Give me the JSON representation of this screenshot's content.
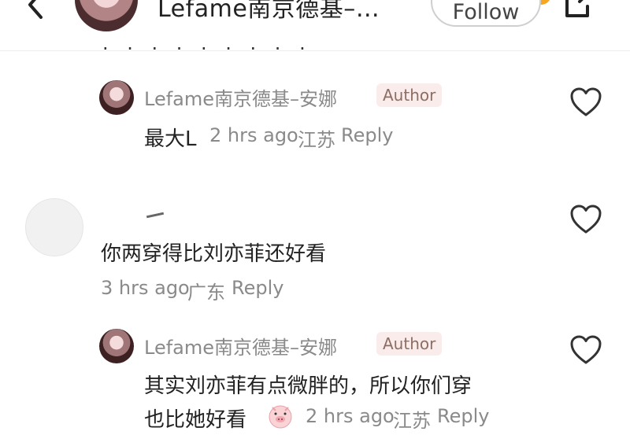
{
  "header": {
    "title": "Lefame南京德基–…",
    "follow_label": "Follow"
  },
  "comments": [
    {
      "author": "Lefame南京德基–安娜",
      "badge": "Author",
      "text": "最大L",
      "time": "2 hrs ago",
      "location": "江苏",
      "reply_label": "Reply"
    },
    {
      "author": "",
      "text": "你两穿得比刘亦菲还好看",
      "time": "3 hrs ago",
      "location": "广东",
      "reply_label": "Reply"
    },
    {
      "author": "Lefame南京德基–安娜",
      "badge": "Author",
      "text_line1": "其实刘亦菲有点微胖的，所以你们穿",
      "text_line2": "也比她好看",
      "time": "2 hrs ago",
      "location": "江苏",
      "reply_label": "Reply"
    }
  ],
  "icons": {
    "back": "back-arrow-icon",
    "share": "share-icon",
    "like": "heart-icon",
    "emoji": "pig-emoji-icon"
  },
  "colors": {
    "badge_bg": "#fbecec",
    "badge_text": "#8d6e63",
    "meta_text": "#8a8a8a",
    "follow_accent": "#f6a623"
  }
}
